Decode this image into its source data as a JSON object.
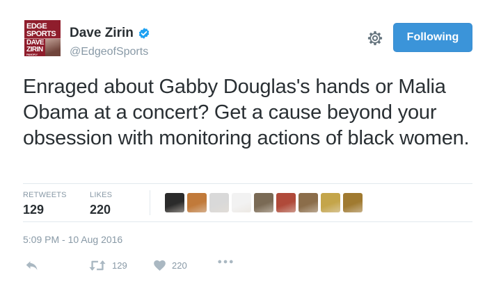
{
  "author": {
    "display_name": "Dave Zirin",
    "handle": "@EdgeofSports",
    "verified": true,
    "avatar_text": [
      "EDGE",
      "SPORTS",
      "DAVE",
      "ZIRIN",
      "PAMOPLY"
    ]
  },
  "follow_button": {
    "label": "Following",
    "color": "#3b94d9"
  },
  "tweet": {
    "text": "Enraged about Gabby Douglas's hands or Malia Obama at a concert? Get a cause beyond your obsession with monitoring actions of black women."
  },
  "stats": {
    "retweets_label": "RETWEETS",
    "retweets_count": "129",
    "likes_label": "LIKES",
    "likes_count": "220"
  },
  "likers": [
    {
      "icon": "avatar-person",
      "color": "#2b2b2b"
    },
    {
      "icon": "avatar-person",
      "color": "#c17a3a"
    },
    {
      "icon": "avatar-cartoon",
      "color": "#d9d9d9"
    },
    {
      "icon": "avatar-sketch",
      "color": "#f2f2f2"
    },
    {
      "icon": "avatar-photo",
      "color": "#7a6a55"
    },
    {
      "icon": "avatar-photo",
      "color": "#b04a3a"
    },
    {
      "icon": "avatar-photo",
      "color": "#8b6d4a"
    },
    {
      "icon": "avatar-cartoon",
      "color": "#c4a54a"
    },
    {
      "icon": "avatar-photo",
      "color": "#a07a30"
    }
  ],
  "timestamp": "5:09 PM - 10 Aug 2016",
  "actions": {
    "retweet_count": "129",
    "like_count": "220"
  },
  "colors": {
    "text": "#292f33",
    "muted": "#8899a6",
    "divider": "#e1e8ed",
    "verified": "#1da1f2"
  }
}
